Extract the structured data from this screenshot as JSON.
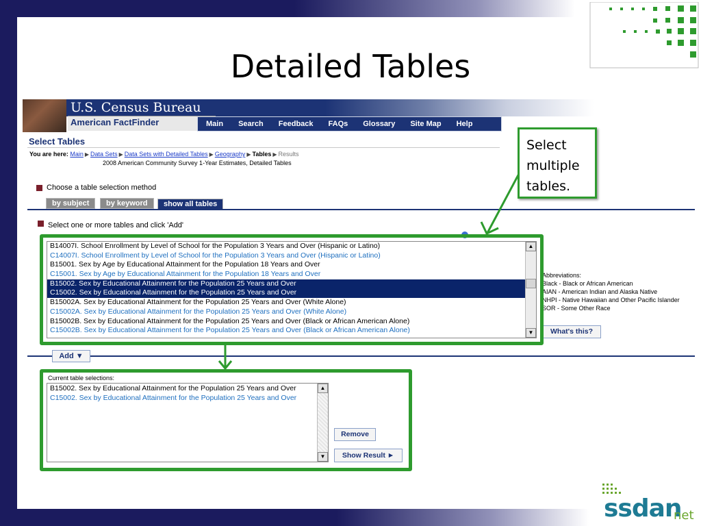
{
  "slide": {
    "title": "Detailed Tables",
    "callout": [
      "Select",
      "multiple",
      "tables."
    ]
  },
  "census": {
    "bureau_name": "U.S. Census Bureau",
    "app_name": "American FactFinder",
    "nav": [
      "Main",
      "Search",
      "Feedback",
      "FAQs",
      "Glossary",
      "Site Map",
      "Help"
    ],
    "page_title": "Select Tables",
    "breadcrumb": {
      "label": "You are here:",
      "links": [
        "Main",
        "Data Sets",
        "Data Sets with Detailed Tables",
        "Geography"
      ],
      "current": "Tables",
      "next": "Results"
    },
    "survey": "2008 American Community Survey 1-Year Estimates, Detailed Tables",
    "choose_method": "Choose a table selection method",
    "tabs": [
      "by subject",
      "by keyword",
      "show all tables"
    ],
    "active_tab": "show all tables",
    "select_prompt": "Select one or more tables and click 'Add'",
    "table_list": [
      {
        "text": "B14007I. School Enrollment by Level of School for the Population 3 Years and Over (Hispanic or Latino)",
        "style": "black"
      },
      {
        "text": "C14007I. School Enrollment by Level of School for the Population 3 Years and Over (Hispanic or Latino)",
        "style": "blue"
      },
      {
        "text": "B15001. Sex by Age by Educational Attainment for the Population 18 Years and Over",
        "style": "black"
      },
      {
        "text": "C15001. Sex by Age by Educational Attainment for the Population 18 Years and Over",
        "style": "blue"
      },
      {
        "text": "B15002. Sex by Educational Attainment for the Population 25 Years and Over",
        "style": "selected"
      },
      {
        "text": "C15002. Sex by Educational Attainment for the Population 25 Years and Over",
        "style": "selected"
      },
      {
        "text": "B15002A. Sex by Educational Attainment for the Population 25 Years and Over (White Alone)",
        "style": "black"
      },
      {
        "text": "C15002A. Sex by Educational Attainment for the Population 25 Years and Over (White Alone)",
        "style": "blue"
      },
      {
        "text": "B15002B. Sex by Educational Attainment for the Population 25 Years and Over (Black or African American Alone)",
        "style": "black"
      },
      {
        "text": "C15002B. Sex by Educational Attainment for the Population 25 Years and Over (Black or African American Alone)",
        "style": "blue"
      }
    ],
    "abbreviations": [
      "Abbreviations:",
      "Black - Black or African American",
      "AIAN - American Indian and Alaska Native",
      "NHPI - Native Hawaiian and Other Pacific Islander",
      "SOR - Some Other Race"
    ],
    "whats_this": "What's this?",
    "add_button": "Add ▼",
    "current_label": "Current table selections:",
    "current_list": [
      {
        "text": "B15002. Sex by Educational Attainment for the Population 25 Years and Over",
        "style": "black"
      },
      {
        "text": "C15002. Sex by Educational Attainment for the Population 25 Years and Over",
        "style": "blue"
      }
    ],
    "remove_button": "Remove",
    "show_result_button": "Show Result ►"
  },
  "branding": {
    "logo_main": "ssdan",
    "logo_suffix": "net"
  },
  "colors": {
    "frame_green": "#2e9b2e",
    "navy": "#1c3375",
    "selection": "#0a246a",
    "link_blue": "#1e6fbf"
  }
}
